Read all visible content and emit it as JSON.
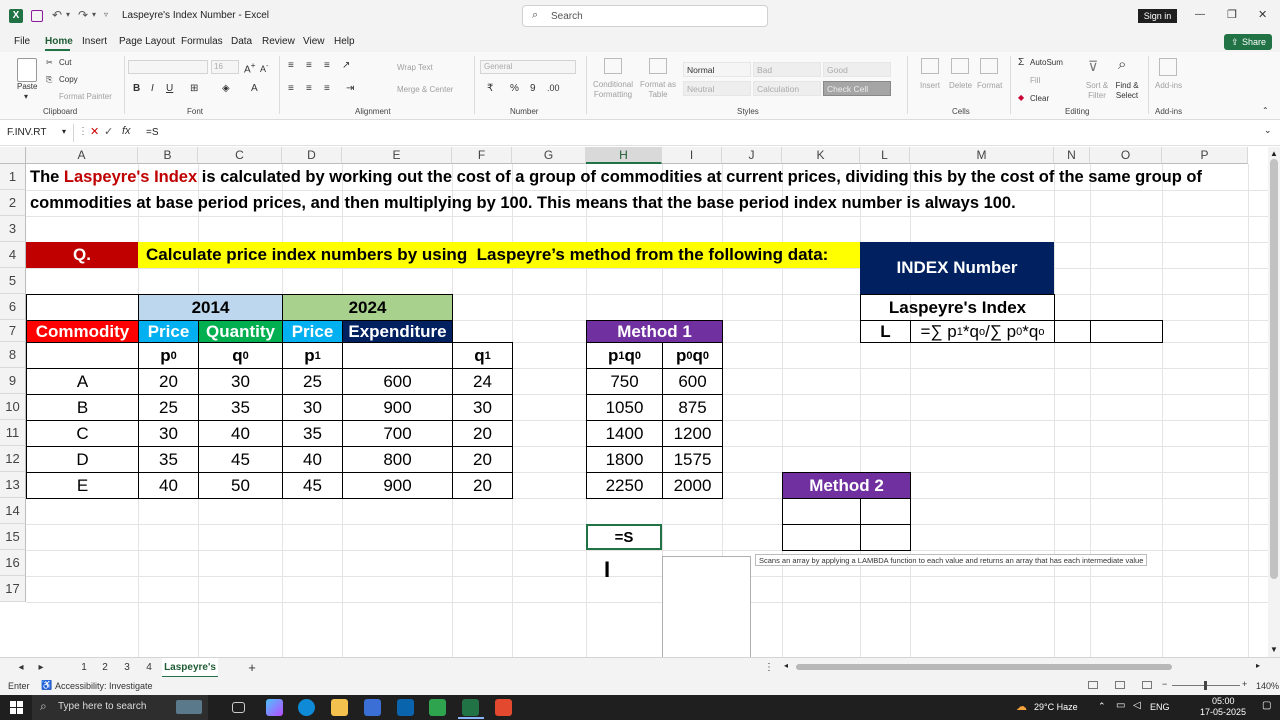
{
  "window": {
    "title": "Laspeyre's Index Number - Excel",
    "search_placeholder": "Search",
    "signin_label": "Sign in",
    "share_label": "Share",
    "min_glyph": "—",
    "max_glyph": "❐",
    "close_glyph": "✕"
  },
  "menu": [
    "File",
    "Home",
    "Insert",
    "Page Layout",
    "Formulas",
    "Data",
    "Review",
    "View",
    "Help"
  ],
  "ribbon": {
    "paste": "Paste",
    "cut": "Cut",
    "copy": "Copy",
    "format_painter": "Format Painter",
    "clipboard": "Clipboard",
    "font_size": "16",
    "font_group": "Font",
    "wrap_text": "Wrap Text",
    "merge_center": "Merge & Center",
    "alignment": "Alignment",
    "number_format": "General",
    "number": "Number",
    "conditional": "Conditional Formatting",
    "format_as_table": "Format as Table",
    "styles": [
      "Normal",
      "Bad",
      "Good",
      "Neutral",
      "Calculation",
      "Check Cell"
    ],
    "styles_group": "Styles",
    "insert": "Insert",
    "delete": "Delete",
    "format": "Format",
    "cells": "Cells",
    "autosum": "AutoSum",
    "fill": "Fill",
    "clear": "Clear",
    "sort_filter": "Sort & Filter",
    "find_select": "Find & Select",
    "editing": "Editing",
    "addins": "Add-ins",
    "addins_group": "Add-ins"
  },
  "formula_bar": {
    "name_box": "F.INV.RT",
    "fx": "fx",
    "formula": "=S"
  },
  "columns": [
    "A",
    "B",
    "C",
    "D",
    "E",
    "F",
    "G",
    "H",
    "I",
    "J",
    "K",
    "L",
    "M",
    "N",
    "O",
    "P"
  ],
  "rows": [
    "1",
    "2",
    "3",
    "4",
    "5",
    "6",
    "7",
    "8",
    "9",
    "10",
    "11",
    "12",
    "13",
    "14",
    "15",
    "16",
    "17"
  ],
  "sheet": {
    "intro_line1_pre": "The ",
    "intro_line1_red": "Laspeyre's Index",
    "intro_line1_post": " is calculated by working out the cost of a group of commodities at current prices, dividing this by the cost of the same group of",
    "intro_line2": "commodities at base period prices, and then multiplying by 100. This means that the base period index number is always 100.",
    "q_label": "Q.",
    "question": "Calculate price index numbers by using  Laspeyre’s method from the following data:",
    "year1": "2014",
    "year2": "2024",
    "h_commodity": "Commodity",
    "h_price1": "Price",
    "h_quantity": "Quantity",
    "h_price2": "Price",
    "h_expenditure": "Expenditure",
    "sub_p0": "p",
    "sub_p0_s": "0",
    "sub_q0": "q",
    "sub_q0_s": "0",
    "sub_p1": "p",
    "sub_p1_s": "1",
    "sub_q1": "q",
    "sub_q1_s": "1",
    "data_rows": [
      {
        "commodity": "A",
        "p0": "20",
        "q0": "30",
        "p1": "25",
        "exp": "600",
        "q1": "24"
      },
      {
        "commodity": "B",
        "p0": "25",
        "q0": "35",
        "p1": "30",
        "exp": "900",
        "q1": "30"
      },
      {
        "commodity": "C",
        "p0": "30",
        "q0": "40",
        "p1": "35",
        "exp": "700",
        "q1": "20"
      },
      {
        "commodity": "D",
        "p0": "35",
        "q0": "45",
        "p1": "40",
        "exp": "800",
        "q1": "20"
      },
      {
        "commodity": "E",
        "p0": "40",
        "q0": "50",
        "p1": "45",
        "exp": "900",
        "q1": "20"
      }
    ],
    "method1": "Method 1",
    "m1_h1": "p",
    "m1_h1_s1": "1",
    "m1_h1_b": "q",
    "m1_h1_s2": "0",
    "m1_h2": "p",
    "m1_h2_s1": "0",
    "m1_h2_b": "q",
    "m1_h2_s2": "0",
    "m1_rows": [
      [
        "750",
        "600"
      ],
      [
        "1050",
        "875"
      ],
      [
        "1400",
        "1200"
      ],
      [
        "1800",
        "1575"
      ],
      [
        "2250",
        "2000"
      ]
    ],
    "method2": "Method 2",
    "index_title": "INDEX Number",
    "laspeyre_label": "Laspeyre's Index",
    "l_label": "L",
    "l_formula_a": "=∑ p",
    "l_formula_a_s": "1",
    "l_formula_b": "*q",
    "l_formula_b_s": "o",
    "l_formula_c": "/∑ p",
    "l_formula_c_s": "0",
    "l_formula_d": "*q",
    "l_formula_d_s": "o",
    "editing_value": "=S",
    "tooltip": "Scans an array by applying a LAMBDA function to each value and returns an array that has each intermediate value"
  },
  "sheet_tabs": [
    "1",
    "2",
    "3",
    "4",
    "Laspeyre's"
  ],
  "active_tab": "Laspeyre's",
  "status": {
    "mode": "Enter",
    "accessibility": "Accessibility: Investigate",
    "zoom": "140%"
  },
  "taskbar": {
    "search_placeholder": "Type here to search",
    "weather": "29°C  Haze",
    "lang": "ENG",
    "time": "05:00",
    "date": "17-05-2025"
  },
  "colors": {
    "excel_green": "#217346",
    "red": "#c00000",
    "yellow": "#ffff00",
    "light_blue": "#bdd7ee",
    "light_green": "#a9d18e",
    "blue": "#00b0f0",
    "green": "#00b050",
    "navy": "#002060",
    "purple": "#7030a0"
  }
}
